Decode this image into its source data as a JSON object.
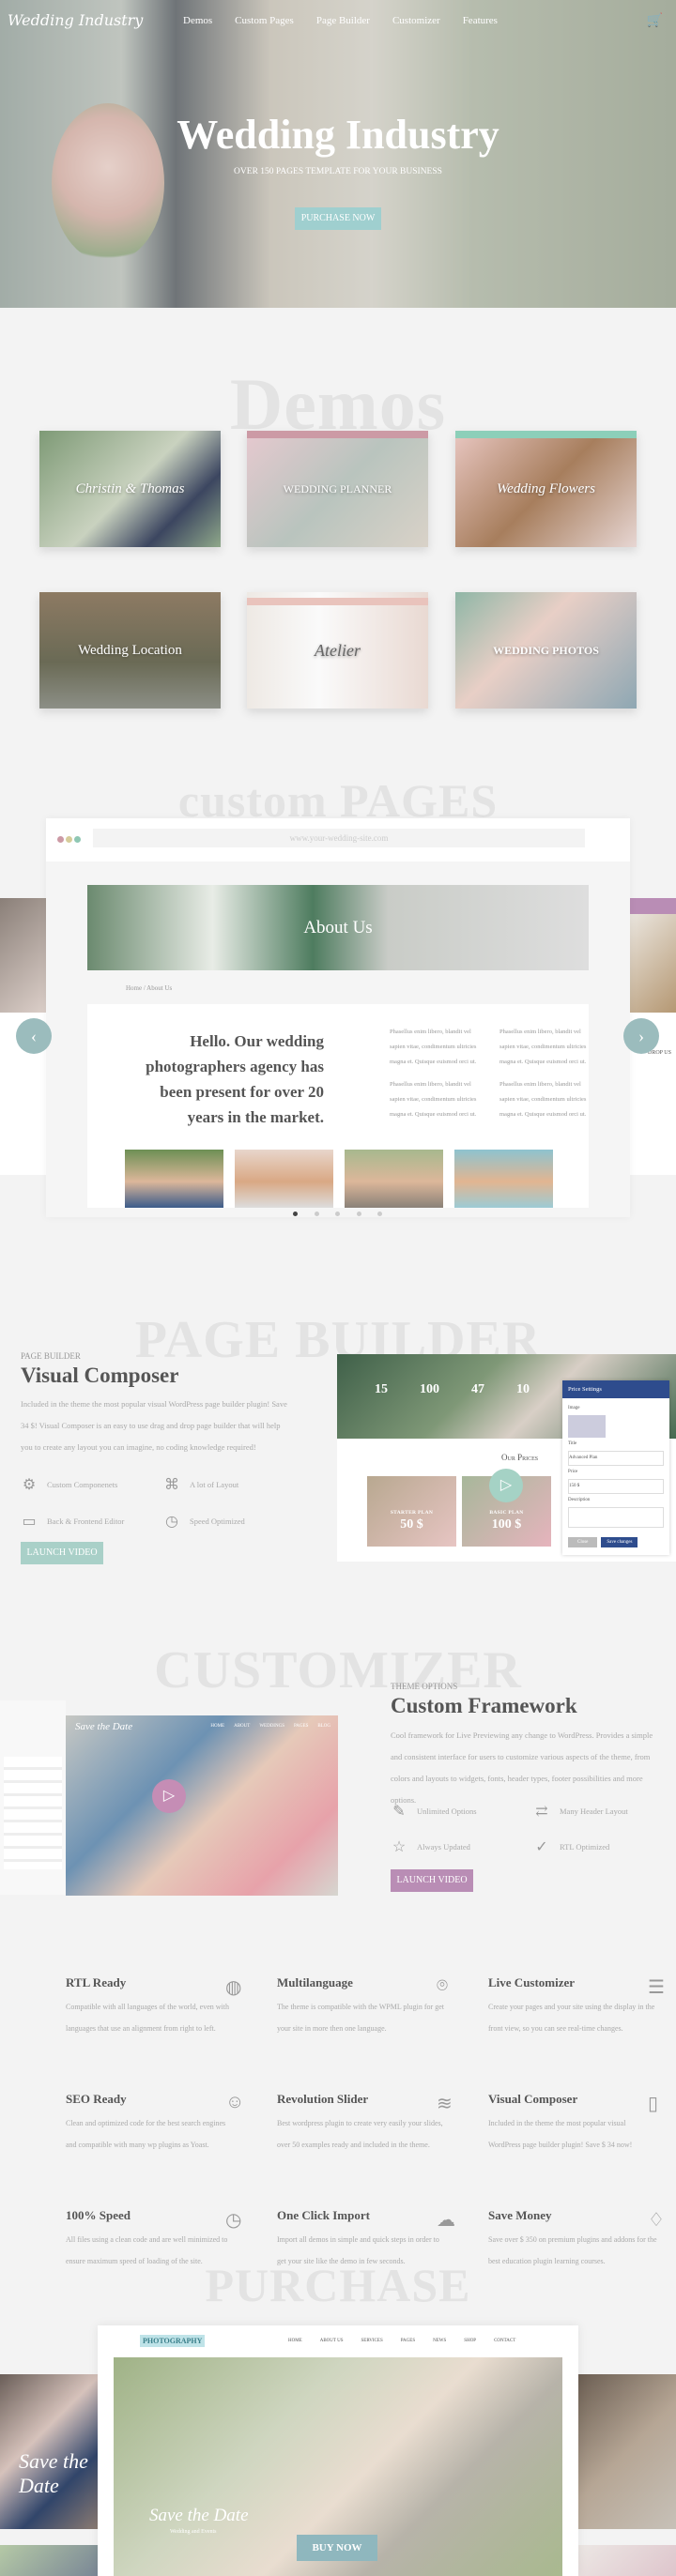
{
  "nav": {
    "logo": "Wedding Industry",
    "items": [
      "Demos",
      "Custom Pages",
      "Page Builder",
      "Customizer",
      "Features"
    ],
    "cart_icon": "cart-icon"
  },
  "hero": {
    "title": "Wedding Industry",
    "subtitle": "OVER 150 PAGES TEMPLATE FOR YOUR BUSINESS",
    "button": "PURCHASE NOW"
  },
  "demos": {
    "watermark": "Demos",
    "cards": [
      "Christin & Thomas",
      "WEDDING PLANNER",
      "Wedding Flowers",
      "Wedding Location",
      "Atelier",
      "WEDDING PHOTOS"
    ]
  },
  "custom_pages": {
    "watermark": "custom PAGES",
    "url": "www.your-wedding-site.com",
    "banner_title": "About Us",
    "breadcrumb": [
      "Home",
      "About Us"
    ],
    "heading": "Hello. Our wedding photographers agency has been present for over 20 years in the market.",
    "lorem": "Phasellus enim libero, blandit vel sapien vitae, condimentum ultricies magna et. Quisque euismod orci ut.",
    "side_heading": "DROP US",
    "prev_icon": "chevron-left-icon",
    "next_icon": "chevron-right-icon",
    "slide_count": 5,
    "active_slide": 1
  },
  "page_builder": {
    "watermark": "PAGE BUILDER",
    "label": "PAGE BUILDER",
    "title": "Visual Composer",
    "description": "Included in the theme the most popular visual WordPress page builder plugin! Save 34 $! Visual Composer is an easy to use drag and drop page builder that will help you to create any layout you can imagine, no coding knowledge required!",
    "features": [
      "Custom Componenets",
      "A lot of Layout",
      "Back & Frontend Editor",
      "Speed Optimized"
    ],
    "button": "LAUNCH VIDEO",
    "preview": {
      "stats": [
        "15",
        "100",
        "47",
        "10"
      ],
      "prices_title": "Our Prices",
      "plans": [
        {
          "name": "STARTER PLAN",
          "price": "50 $"
        },
        {
          "name": "BASIC PLAN",
          "price": "100 $"
        }
      ],
      "panel_title": "Price Settings",
      "fields": [
        "Image",
        "Title",
        "Advanced Plan",
        "Price",
        "150 $",
        "Description"
      ],
      "close": "Close",
      "save": "Save changes"
    }
  },
  "customizer": {
    "watermark": "CUSTOMIZER",
    "label": "THEME OPTIONS",
    "title": "Custom Framework",
    "description": "Cool framework for Live Previewing any change to WordPress. Provides a simple and consistent interface for users to customize various aspects of the theme, from colors and layouts to widgets, fonts, header types, footer possibilities and more options.",
    "features": [
      "Unlimited Options",
      "Many Header Layout",
      "Always Updated",
      "RTL Optimized"
    ],
    "button": "LAUNCH VIDEO",
    "preview": {
      "logo": "Save the Date",
      "nav": [
        "HOME",
        "ABOUT",
        "WEDDINGS",
        "PAGES",
        "BLOG"
      ]
    }
  },
  "features": [
    {
      "title": "RTL Ready",
      "text": "Compatible with all languages of the world, even with languages that use an alignment from right to left.",
      "icon": "globe-icon"
    },
    {
      "title": "Multilanguage",
      "text": "The theme is compatible with the WPML plugin for get your site in more then one language.",
      "icon": "map-pin-icon"
    },
    {
      "title": "Live Customizer",
      "text": "Create your pages and your site using the display in the front view, so you can see real-time changes.",
      "icon": "sliders-icon"
    },
    {
      "title": "SEO Ready",
      "text": "Clean and optimized code for the best search engines and compatible with many wp plugins as Yoast.",
      "icon": "smiley-icon"
    },
    {
      "title": "Revolution Slider",
      "text": "Best wordpress plugin to create very easily your slides, over 50 examples ready and included in the theme.",
      "icon": "layers-icon"
    },
    {
      "title": "Visual Composer",
      "text": "Included in the theme the most popular visual WordPress page builder plugin! Save $ 34 now!",
      "icon": "document-icon"
    },
    {
      "title": "100% Speed",
      "text": "All files using a clean code and are well minimized to ensure maximum speed of loading of the site.",
      "icon": "clock-icon"
    },
    {
      "title": "One Click Import",
      "text": "Import all demos in simple and quick steps in order to get your site like the demo in few seconds.",
      "icon": "cloud-upload-icon"
    },
    {
      "title": "Save Money",
      "text": "Save over $ 350 on premium plugins and addons for the best education plugin learning courses.",
      "icon": "lightbulb-icon"
    }
  ],
  "purchase": {
    "watermark": "PURCHASE",
    "logo": "PHOTOGRAPHY",
    "nav": [
      "HOME",
      "ABOUT US",
      "SERVICES",
      "PAGES",
      "NEWS",
      "SHOP",
      "CONTACT"
    ],
    "script_title": "Save the Date",
    "script_sub": "Wedding and Events",
    "button": "BUY NOW",
    "side_title": "Save the Date"
  },
  "colors": {
    "teal": "#9fcfcf",
    "mauve": "#b98db5",
    "background": "#f3f3f3"
  }
}
